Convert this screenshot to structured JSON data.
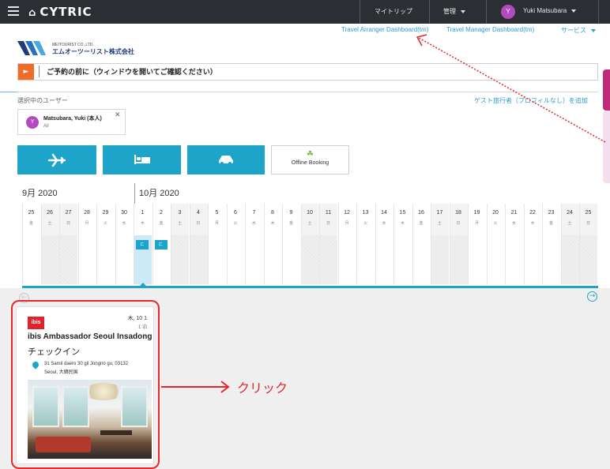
{
  "header": {
    "logo_text": "cytric",
    "home_glyph": "⌂",
    "my_trip": "マイトリップ",
    "admin": "管理",
    "user_initial": "Y",
    "user_name": "Yuki Matsubara"
  },
  "sublinks": {
    "arranger": "Travel Arranger Dashboard(tm)",
    "manager": "Travel Manager Dashboard(tm)",
    "services": "サービス"
  },
  "company": {
    "small_name": "MEITOURIST CO.,LTD.",
    "name": "エムオーツーリスト株式会社"
  },
  "notice": {
    "text": "ご予約の前に（ウィンドウを開いてご確認ください）"
  },
  "selection": {
    "label": "選択中のユーザー",
    "guest_link": "ゲスト旅行者（プロフィルなし）を追加",
    "user_initial": "Y",
    "user_name": "Matsubara, Yuki (本人)",
    "user_sub": "All"
  },
  "booking_tiles": {
    "offline_label": "Offline Booking"
  },
  "calendar": {
    "month_sep": "9月 2020",
    "month_oct": "10月 2020",
    "days": [
      {
        "num": "25",
        "wd": "金"
      },
      {
        "num": "26",
        "wd": "土"
      },
      {
        "num": "27",
        "wd": "日"
      },
      {
        "num": "28",
        "wd": "月"
      },
      {
        "num": "29",
        "wd": "火"
      },
      {
        "num": "30",
        "wd": "水"
      },
      {
        "num": "1",
        "wd": "木"
      },
      {
        "num": "2",
        "wd": "金"
      },
      {
        "num": "3",
        "wd": "土"
      },
      {
        "num": "4",
        "wd": "日"
      },
      {
        "num": "5",
        "wd": "月"
      },
      {
        "num": "6",
        "wd": "火"
      },
      {
        "num": "7",
        "wd": "水"
      },
      {
        "num": "8",
        "wd": "木"
      },
      {
        "num": "9",
        "wd": "金"
      },
      {
        "num": "10",
        "wd": "土"
      },
      {
        "num": "11",
        "wd": "日"
      },
      {
        "num": "12",
        "wd": "月"
      },
      {
        "num": "13",
        "wd": "火"
      },
      {
        "num": "14",
        "wd": "水"
      },
      {
        "num": "15",
        "wd": "木"
      },
      {
        "num": "16",
        "wd": "金"
      },
      {
        "num": "17",
        "wd": "土"
      },
      {
        "num": "18",
        "wd": "日"
      },
      {
        "num": "19",
        "wd": "月"
      },
      {
        "num": "20",
        "wd": "火"
      },
      {
        "num": "21",
        "wd": "水"
      },
      {
        "num": "22",
        "wd": "木"
      },
      {
        "num": "23",
        "wd": "金"
      },
      {
        "num": "24",
        "wd": "土"
      },
      {
        "num": "25",
        "wd": "日"
      }
    ]
  },
  "hotel_card": {
    "logo": "ibis",
    "date": "木, 10 1",
    "nights": "1 泊",
    "title": "ibis Ambassador Seoul Insadong",
    "checkin": "チェックイン",
    "addr1": "31 Samil daero 30 gil Jongno gu, 03132",
    "addr2": "Seoul, 大韓民国"
  },
  "annotation": {
    "click_label": "クリック",
    "color": "#e0282b"
  },
  "colors": {
    "accent": "#1ea3c9",
    "topbar": "#2b2e33",
    "notice": "#f06a28",
    "avatar": "#b44ac0"
  }
}
